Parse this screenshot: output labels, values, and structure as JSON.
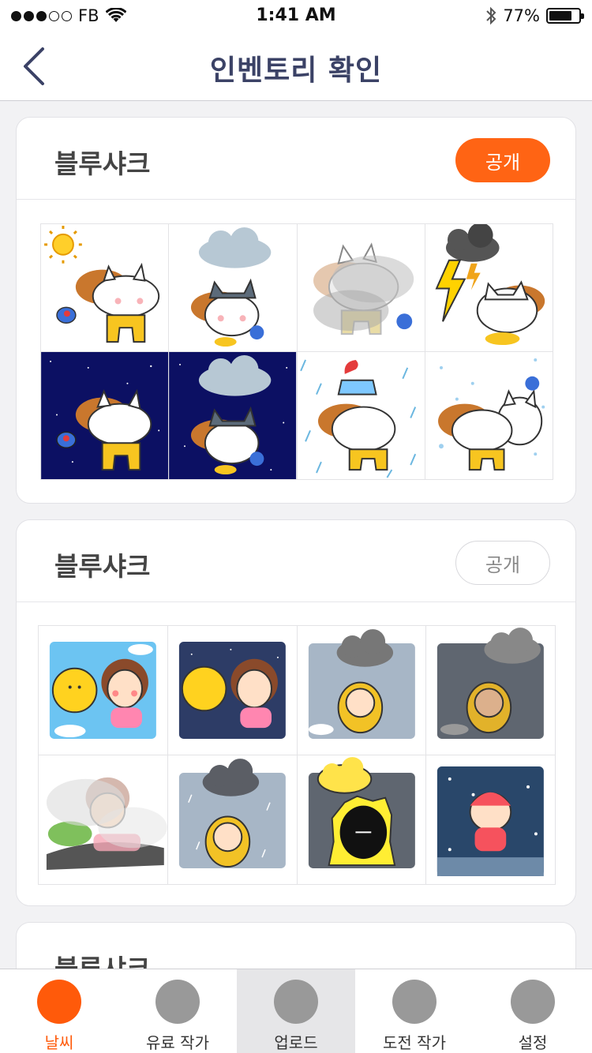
{
  "status_bar": {
    "carrier": "FB",
    "time": "1:41 AM",
    "battery": "77%",
    "battery_level": 0.77
  },
  "header": {
    "title": "인벤토리 확인"
  },
  "cards": [
    {
      "title": "블루샤크",
      "publish_label": "공개",
      "publish_active": true
    },
    {
      "title": "블루샤크",
      "publish_label": "공개",
      "publish_active": false
    },
    {
      "title": "블루샤크"
    }
  ],
  "tabs": [
    {
      "label": "날씨",
      "active": true
    },
    {
      "label": "유료 작가",
      "active": false
    },
    {
      "label": "업로드",
      "active": false
    },
    {
      "label": "도전 작가",
      "active": false
    },
    {
      "label": "설정",
      "active": false
    }
  ],
  "colors": {
    "accent": "#ff6414",
    "title": "#3b4266",
    "tab_inactive": "#999999"
  }
}
